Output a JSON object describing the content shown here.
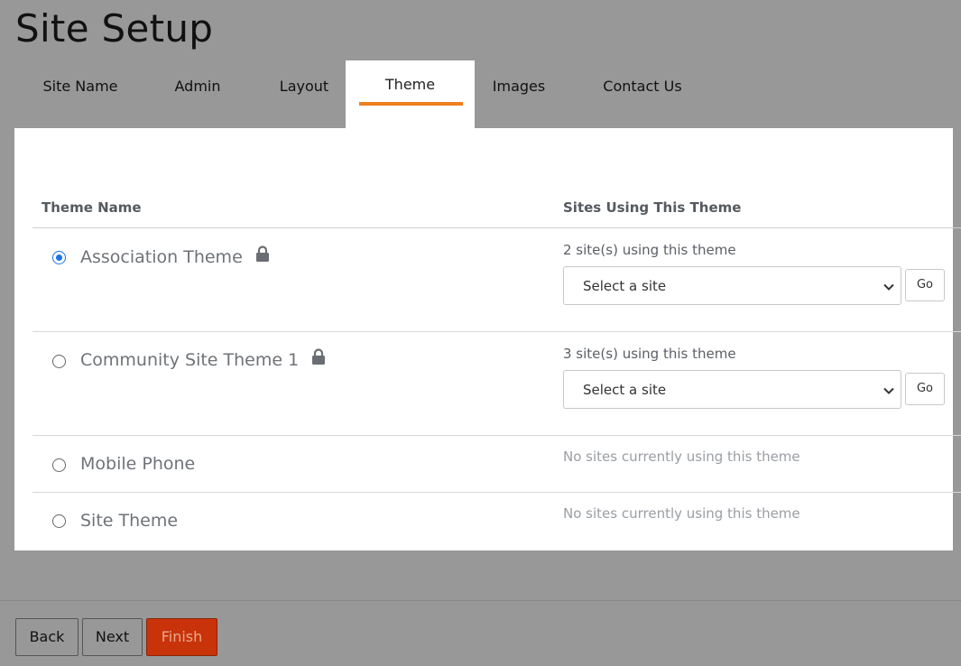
{
  "page": {
    "title": "Site Setup"
  },
  "tabs": [
    {
      "label": "Site Name",
      "active": false
    },
    {
      "label": "Admin",
      "active": false
    },
    {
      "label": "Layout",
      "active": false
    },
    {
      "label": "Theme",
      "active": true
    },
    {
      "label": "Images",
      "active": false
    },
    {
      "label": "Contact Us",
      "active": false
    }
  ],
  "table": {
    "columns": [
      "Theme Name",
      "Sites Using This Theme"
    ],
    "rows": [
      {
        "name": "Association Theme",
        "selected": true,
        "locked": true,
        "usage": "2 site(s) using this theme",
        "select_value": "Select a site",
        "go_label": "Go"
      },
      {
        "name": "Community Site Theme 1",
        "selected": false,
        "locked": true,
        "usage": "3 site(s) using this theme",
        "select_value": "Select a site",
        "go_label": "Go"
      },
      {
        "name": "Mobile Phone",
        "selected": false,
        "locked": false,
        "usage": "No sites currently using this theme"
      },
      {
        "name": "Site Theme",
        "selected": false,
        "locked": false,
        "usage": "No sites currently using this theme"
      }
    ]
  },
  "footer": {
    "back_label": "Back",
    "next_label": "Next",
    "finish_label": "Finish"
  },
  "icons": {
    "lock": "lock-icon",
    "dropdown": "chevron-down-icon"
  },
  "colors": {
    "accent_underline": "#ee8020",
    "radio_selected": "#1a73e8",
    "finish_button": "#c8330a",
    "background": "#989898"
  }
}
